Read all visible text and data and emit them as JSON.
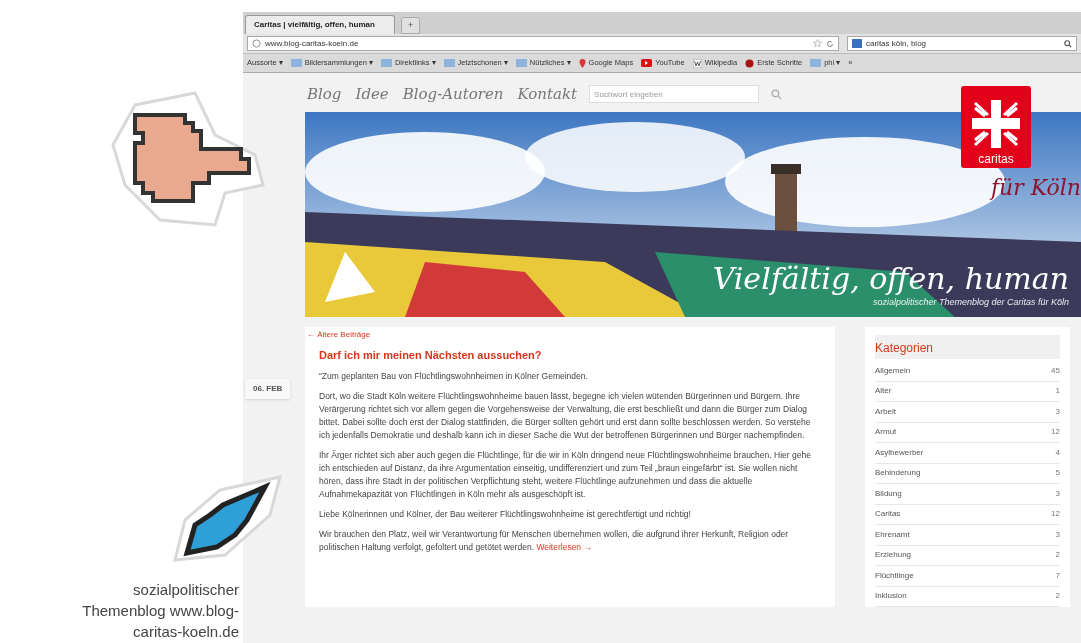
{
  "figure": {
    "caption": "sozialpolitischer Themenblog www.blog-caritas-koeln.de"
  },
  "browser": {
    "tabs": [
      {
        "label": "Caritas | vielfältig, offen, human",
        "selected": true
      }
    ],
    "new_tab": "+",
    "url": "www.blog-caritas-koeln.de",
    "search": "caritas köln, blog",
    "bookmarks": [
      {
        "kind": "menu",
        "label": "Aussorte ▾"
      },
      {
        "kind": "folder",
        "label": "Bildersammlungen ▾"
      },
      {
        "kind": "folder",
        "label": "Direktlinks ▾"
      },
      {
        "kind": "folder",
        "label": "Jetztschonen ▾"
      },
      {
        "kind": "folder",
        "label": "Nützliches ▾"
      },
      {
        "kind": "maps",
        "label": "Google Maps"
      },
      {
        "kind": "video",
        "label": "YouTube"
      },
      {
        "kind": "wiki",
        "label": "Wikipedia"
      },
      {
        "kind": "start",
        "label": "Erste Schritte"
      },
      {
        "kind": "folder",
        "label": "phi ▾"
      },
      {
        "kind": "menu",
        "label": "»"
      }
    ]
  },
  "blog": {
    "nav": [
      "Blog",
      "Idee",
      "Blog-Autoren",
      "Kontakt"
    ],
    "search_placeholder": "Suchwort eingeben",
    "logo": {
      "label": "caritas",
      "tagline": "für Köln"
    },
    "banner": {
      "title": "Vielfältig, offen, human",
      "subtitle": "sozialpolitischer Themenblog der Caritas für Köln"
    },
    "older_posts": "← Ältere Beiträge",
    "post": {
      "date": "06. FEB",
      "title": "Darf ich mir meinen Nächsten aussuchen?",
      "paragraphs": [
        "“Zum geplanten Bau von Flüchtlingswohnheimen in Kölner Gemeinden.",
        "Dort, wo die Stadt Köln weitere Flüchtlingswohnheime bauen lässt, begegne ich vielen wütenden Bürgerinnen und Bürgern. Ihre Verärgerung richtet sich vor allem gegen die Vorgehensweise der Verwaltung, die erst beschließt und dann die Bürger zum Dialog bittet. Dabei sollte doch erst der Dialog stattfinden, die Bürger sollten gehört und erst dann sollte beschlossen werden. So verstehe ich jedenfalls Demokratie und deshalb kann ich in dieser Sache die Wut der betroffenen Bürgerinnen und Bürger nachempfinden.",
        "Ihr Ärger richtet sich aber auch gegen die Flüchtlinge, für die wir in Köln dringend neue Flüchtlingswohnheime brauchen. Hier gehe ich entschieden auf Distanz, da ihre Argumentation einseitig, undifferenziert und zum Teil „braun eingefärbt“ ist. Sie wollen nicht hören, dass ihre Stadt in der politischen Verpflichtung steht, weitere Flüchtlinge aufzunehmen und dass die aktuelle Aufnahmekapazität von Flüchtlingen in Köln mehr als ausgeschöpft ist.",
        "Liebe Kölnerinnen und Kölner, der Bau weiterer Flüchtlingswohnheime ist gerechtfertigt und richtig!",
        "Wir brauchen den Platz, weil wir Verantwortung für Menschen übernehmen wollen, die aufgrund ihrer Herkunft, Religion oder politischen Haltung verfolgt, gefoltert und getötet werden."
      ],
      "read_more": "Weiterlesen →"
    },
    "sidebar": {
      "title": "Kategorien",
      "categories": [
        {
          "label": "Allgemein",
          "count": "45"
        },
        {
          "label": "Alter",
          "count": "1"
        },
        {
          "label": "Arbeit",
          "count": "3"
        },
        {
          "label": "Armut",
          "count": "12"
        },
        {
          "label": "Asylbewerber",
          "count": "4"
        },
        {
          "label": "Behinderung",
          "count": "5"
        },
        {
          "label": "Bildung",
          "count": "3"
        },
        {
          "label": "Caritas",
          "count": "12"
        },
        {
          "label": "Ehrenamt",
          "count": "3"
        },
        {
          "label": "Erziehung",
          "count": "2"
        },
        {
          "label": "Flüchtlinge",
          "count": "7"
        },
        {
          "label": "Inklusion",
          "count": "2"
        }
      ]
    }
  }
}
